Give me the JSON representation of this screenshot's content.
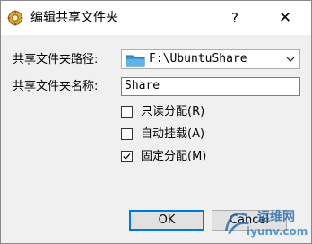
{
  "window": {
    "title": "编辑共享文件夹",
    "help": "?",
    "close": "✕"
  },
  "form": {
    "path_label": "共享文件夹路径:",
    "path_value": "F:\\UbuntuShare",
    "name_label": "共享文件夹名称:",
    "name_value": "Share",
    "checkboxes": [
      {
        "label": "只读分配(R)",
        "checked": false
      },
      {
        "label": "自动挂载(A)",
        "checked": false
      },
      {
        "label": "固定分配(M)",
        "checked": true
      }
    ]
  },
  "buttons": {
    "ok": "OK",
    "cancel": "Cancel"
  },
  "watermark": {
    "line1": "运维网",
    "line2": "iyunv.com"
  },
  "colors": {
    "accent": "#0078d7",
    "folder": "#3a9ad9"
  }
}
